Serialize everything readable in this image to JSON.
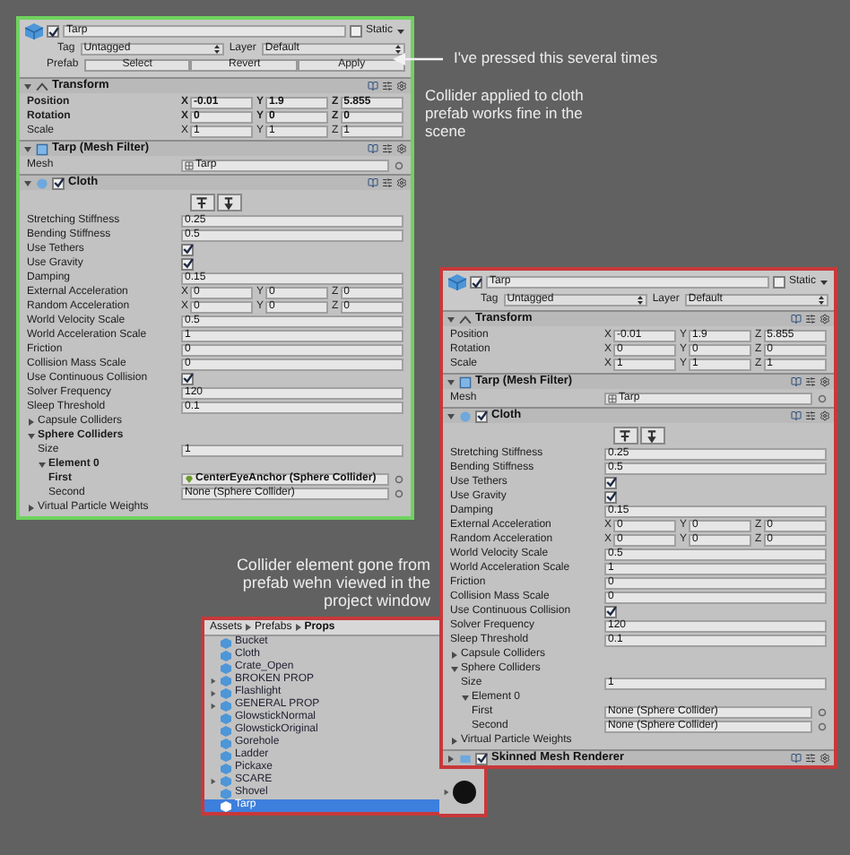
{
  "annotations": [
    {
      "text": "I've pressed this several times"
    },
    {
      "text": "Collider applied to cloth prefab works fine in the scene"
    },
    {
      "text": "Collider element gone from prefab wehn viewed in the project window"
    }
  ],
  "inspectors": [
    {
      "color": "#6fd35e",
      "name": "Tarp",
      "active": true,
      "static_label": "Static",
      "static": false,
      "tag_label": "Tag",
      "tag": "Untagged",
      "layer_label": "Layer",
      "layer": "Default",
      "prefab": {
        "label": "Prefab",
        "buttons": [
          "Select",
          "Revert",
          "Apply"
        ]
      },
      "components": [
        {
          "kind": "transform",
          "title": "Transform",
          "expanded": true,
          "rows": [
            {
              "kind": "vec3",
              "label": "Position",
              "bold": true,
              "axes": [
                {
                  "axis": "X",
                  "value": "-0.01"
                },
                {
                  "axis": "Y",
                  "value": "1.9"
                },
                {
                  "axis": "Z",
                  "value": "5.855"
                }
              ]
            },
            {
              "kind": "vec3",
              "label": "Rotation",
              "bold": true,
              "axes": [
                {
                  "axis": "X",
                  "value": "0"
                },
                {
                  "axis": "Y",
                  "value": "0"
                },
                {
                  "axis": "Z",
                  "value": "0"
                }
              ]
            },
            {
              "kind": "vec3",
              "label": "Scale",
              "bold": false,
              "axes": [
                {
                  "axis": "X",
                  "value": "1"
                },
                {
                  "axis": "Y",
                  "value": "1"
                },
                {
                  "axis": "Z",
                  "value": "1"
                }
              ]
            }
          ]
        },
        {
          "kind": "meshfilter",
          "title": "Tarp (Mesh Filter)",
          "expanded": true,
          "rows": [
            {
              "kind": "mesh",
              "label": "Mesh",
              "value": "Tarp"
            }
          ]
        },
        {
          "kind": "cloth",
          "title": "Cloth",
          "expanded": true,
          "enabled": true,
          "rows": [
            {
              "kind": "tools"
            },
            {
              "kind": "text",
              "label": "Stretching Stiffness",
              "value": "0.25"
            },
            {
              "kind": "text",
              "label": "Bending Stiffness",
              "value": "0.5"
            },
            {
              "kind": "check",
              "label": "Use Tethers",
              "checked": true
            },
            {
              "kind": "check",
              "label": "Use Gravity",
              "checked": true
            },
            {
              "kind": "text",
              "label": "Damping",
              "value": "0.15"
            },
            {
              "kind": "vec3",
              "label": "External Acceleration",
              "bold": false,
              "axes": [
                {
                  "axis": "X",
                  "value": "0"
                },
                {
                  "axis": "Y",
                  "value": "0"
                },
                {
                  "axis": "Z",
                  "value": "0"
                }
              ]
            },
            {
              "kind": "vec3",
              "label": "Random Acceleration",
              "bold": false,
              "axes": [
                {
                  "axis": "X",
                  "value": "0"
                },
                {
                  "axis": "Y",
                  "value": "0"
                },
                {
                  "axis": "Z",
                  "value": "0"
                }
              ]
            },
            {
              "kind": "text",
              "label": "World Velocity Scale",
              "value": "0.5"
            },
            {
              "kind": "text",
              "label": "World Acceleration Scale",
              "value": "1"
            },
            {
              "kind": "text",
              "label": "Friction",
              "value": "0"
            },
            {
              "kind": "text",
              "label": "Collision Mass Scale",
              "value": "0"
            },
            {
              "kind": "check",
              "label": "Use Continuous Collision",
              "checked": true
            },
            {
              "kind": "text",
              "label": "Solver Frequency",
              "value": "120"
            },
            {
              "kind": "text",
              "label": "Sleep Threshold",
              "value": "0.1"
            },
            {
              "kind": "foldout",
              "label": "Capsule Colliders",
              "expanded": false,
              "bold": false
            },
            {
              "kind": "foldout",
              "label": "Sphere Colliders",
              "expanded": true,
              "bold": true,
              "children": [
                {
                  "kind": "text",
                  "label": "Size",
                  "value": "1"
                },
                {
                  "kind": "foldout",
                  "label": "Element 0",
                  "expanded": true,
                  "bold": true,
                  "children": [
                    {
                      "kind": "objref",
                      "label": "First",
                      "value": "CenterEyeAnchor (Sphere Collider)",
                      "bold": true,
                      "assigned": true
                    },
                    {
                      "kind": "objref",
                      "label": "Second",
                      "value": "None (Sphere Collider)",
                      "bold": false,
                      "assigned": false
                    }
                  ]
                }
              ]
            },
            {
              "kind": "foldout",
              "label": "Virtual Particle Weights",
              "expanded": false,
              "bold": false
            }
          ]
        }
      ]
    },
    {
      "color": "#c8383a",
      "name": "Tarp",
      "active": true,
      "static_label": "Static",
      "static": false,
      "tag_label": "Tag",
      "tag": "Untagged",
      "layer_label": "Layer",
      "layer": "Default",
      "components": [
        {
          "kind": "transform",
          "title": "Transform",
          "expanded": true,
          "rows": [
            {
              "kind": "vec3",
              "label": "Position",
              "bold": false,
              "axes": [
                {
                  "axis": "X",
                  "value": "-0.01"
                },
                {
                  "axis": "Y",
                  "value": "1.9"
                },
                {
                  "axis": "Z",
                  "value": "5.855"
                }
              ]
            },
            {
              "kind": "vec3",
              "label": "Rotation",
              "bold": false,
              "axes": [
                {
                  "axis": "X",
                  "value": "0"
                },
                {
                  "axis": "Y",
                  "value": "0"
                },
                {
                  "axis": "Z",
                  "value": "0"
                }
              ]
            },
            {
              "kind": "vec3",
              "label": "Scale",
              "bold": false,
              "axes": [
                {
                  "axis": "X",
                  "value": "1"
                },
                {
                  "axis": "Y",
                  "value": "1"
                },
                {
                  "axis": "Z",
                  "value": "1"
                }
              ]
            }
          ]
        },
        {
          "kind": "meshfilter",
          "title": "Tarp (Mesh Filter)",
          "expanded": true,
          "rows": [
            {
              "kind": "mesh",
              "label": "Mesh",
              "value": "Tarp"
            }
          ]
        },
        {
          "kind": "cloth",
          "title": "Cloth",
          "expanded": true,
          "enabled": true,
          "rows": [
            {
              "kind": "tools"
            },
            {
              "kind": "text",
              "label": "Stretching Stiffness",
              "value": "0.25"
            },
            {
              "kind": "text",
              "label": "Bending Stiffness",
              "value": "0.5"
            },
            {
              "kind": "check",
              "label": "Use Tethers",
              "checked": true
            },
            {
              "kind": "check",
              "label": "Use Gravity",
              "checked": true
            },
            {
              "kind": "text",
              "label": "Damping",
              "value": "0.15"
            },
            {
              "kind": "vec3",
              "label": "External Acceleration",
              "bold": false,
              "axes": [
                {
                  "axis": "X",
                  "value": "0"
                },
                {
                  "axis": "Y",
                  "value": "0"
                },
                {
                  "axis": "Z",
                  "value": "0"
                }
              ]
            },
            {
              "kind": "vec3",
              "label": "Random Acceleration",
              "bold": false,
              "axes": [
                {
                  "axis": "X",
                  "value": "0"
                },
                {
                  "axis": "Y",
                  "value": "0"
                },
                {
                  "axis": "Z",
                  "value": "0"
                }
              ]
            },
            {
              "kind": "text",
              "label": "World Velocity Scale",
              "value": "0.5"
            },
            {
              "kind": "text",
              "label": "World Acceleration Scale",
              "value": "1"
            },
            {
              "kind": "text",
              "label": "Friction",
              "value": "0"
            },
            {
              "kind": "text",
              "label": "Collision Mass Scale",
              "value": "0"
            },
            {
              "kind": "check",
              "label": "Use Continuous Collision",
              "checked": true
            },
            {
              "kind": "text",
              "label": "Solver Frequency",
              "value": "120"
            },
            {
              "kind": "text",
              "label": "Sleep Threshold",
              "value": "0.1"
            },
            {
              "kind": "foldout",
              "label": "Capsule Colliders",
              "expanded": false,
              "bold": false
            },
            {
              "kind": "foldout",
              "label": "Sphere Colliders",
              "expanded": true,
              "bold": false,
              "children": [
                {
                  "kind": "text",
                  "label": "Size",
                  "value": "1"
                },
                {
                  "kind": "foldout",
                  "label": "Element 0",
                  "expanded": true,
                  "bold": false,
                  "children": [
                    {
                      "kind": "objref",
                      "label": "First",
                      "value": "None (Sphere Collider)",
                      "bold": false,
                      "assigned": false
                    },
                    {
                      "kind": "objref",
                      "label": "Second",
                      "value": "None (Sphere Collider)",
                      "bold": false,
                      "assigned": false
                    }
                  ]
                }
              ]
            },
            {
              "kind": "foldout",
              "label": "Virtual Particle Weights",
              "expanded": false,
              "bold": false
            }
          ]
        },
        {
          "kind": "skinned",
          "title": "Skinned Mesh Renderer",
          "expanded": false,
          "enabled": true
        }
      ]
    }
  ],
  "project": {
    "breadcrumb": [
      "Assets",
      "Prefabs",
      "Props"
    ],
    "items": [
      {
        "name": "Bucket",
        "has_children": false,
        "selected": false
      },
      {
        "name": "Cloth",
        "has_children": false,
        "selected": false
      },
      {
        "name": "Crate_Open",
        "has_children": false,
        "selected": false
      },
      {
        "name": "BROKEN PROP",
        "has_children": true,
        "selected": false
      },
      {
        "name": "Flashlight",
        "has_children": true,
        "selected": false
      },
      {
        "name": "GENERAL PROP",
        "has_children": true,
        "selected": false
      },
      {
        "name": "GlowstickNormal",
        "has_children": false,
        "selected": false
      },
      {
        "name": "GlowstickOriginal",
        "has_children": false,
        "selected": false
      },
      {
        "name": "Gorehole",
        "has_children": false,
        "selected": false
      },
      {
        "name": "Ladder",
        "has_children": false,
        "selected": false
      },
      {
        "name": "Pickaxe",
        "has_children": false,
        "selected": false
      },
      {
        "name": "SCARE",
        "has_children": true,
        "selected": false
      },
      {
        "name": "Shovel",
        "has_children": false,
        "selected": false
      },
      {
        "name": "Tarp",
        "has_children": false,
        "selected": true
      }
    ]
  }
}
